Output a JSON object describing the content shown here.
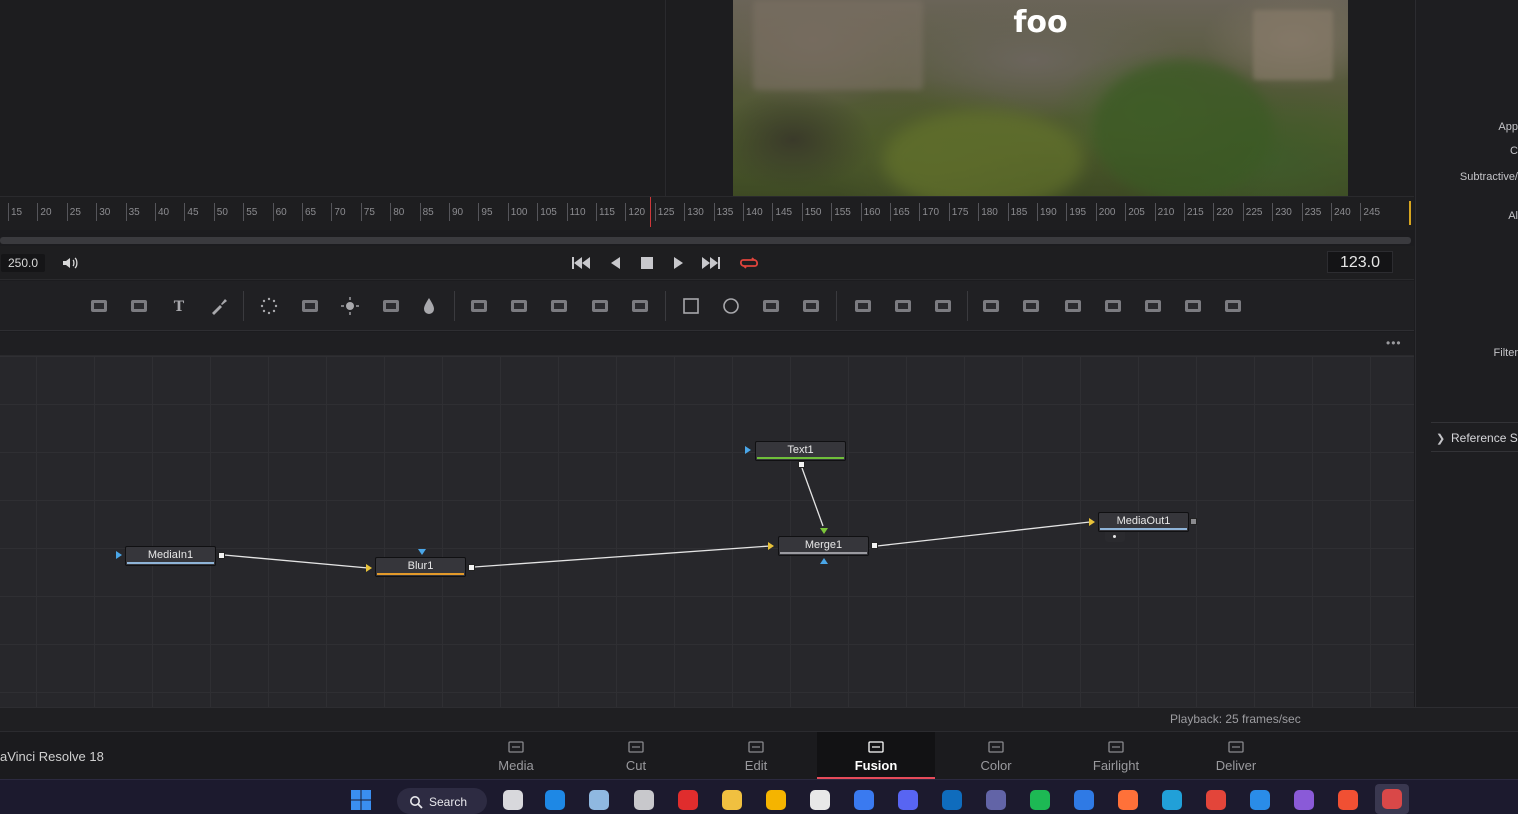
{
  "viewer": {
    "overlay_text": "foo"
  },
  "ruler": {
    "labels": [
      "15",
      "20",
      "25",
      "30",
      "35",
      "40",
      "45",
      "50",
      "55",
      "60",
      "65",
      "70",
      "75",
      "80",
      "85",
      "90",
      "95",
      "100",
      "105",
      "110",
      "115",
      "120",
      "125",
      "130",
      "135",
      "140",
      "145",
      "150",
      "155",
      "160",
      "165",
      "170",
      "175",
      "180",
      "185",
      "190",
      "195",
      "200",
      "205",
      "210",
      "215",
      "220",
      "225",
      "230",
      "235",
      "240",
      "245"
    ]
  },
  "transport": {
    "end_frame": "250.0",
    "current_frame": "123.0",
    "buttons": [
      "go-to-start",
      "step-back",
      "stop",
      "play",
      "go-to-end",
      "loop"
    ]
  },
  "toolbar": {
    "tools": [
      "background-icon",
      "fast-noise-icon",
      "text-icon",
      "paint-icon",
      "particles-icon",
      "color-curves-icon",
      "brightness-contrast-icon",
      "color-corrector-icon",
      "blur-drop-icon",
      "transform-icon",
      "merge-icon",
      "matte-control-icon",
      "resize-icon",
      "loop-icon",
      "rectangle-mask-icon",
      "ellipse-mask-icon",
      "polygon-mask-icon",
      "bspline-mask-icon",
      "particle-emitter-icon",
      "particle-render-icon",
      "particle-style-icon",
      "image-plane-3d-icon",
      "shape-3d-icon",
      "text-3d-icon",
      "merge-3d-icon",
      "renderer-3d-icon",
      "camera-3d-icon",
      "light-3d-icon"
    ]
  },
  "nodes": {
    "text1": "Text1",
    "mediain1": "MediaIn1",
    "blur1": "Blur1",
    "merge1": "Merge1",
    "mediaout1": "MediaOut1"
  },
  "status": {
    "playback": "Playback: 25 frames/sec"
  },
  "app": {
    "name": "aVinci Resolve 18"
  },
  "pages": [
    {
      "label": "Media",
      "icon": "media-page-icon"
    },
    {
      "label": "Cut",
      "icon": "cut-page-icon"
    },
    {
      "label": "Edit",
      "icon": "edit-page-icon"
    },
    {
      "label": "Fusion",
      "icon": "fusion-page-icon",
      "active": true
    },
    {
      "label": "Color",
      "icon": "color-page-icon"
    },
    {
      "label": "Fairlight",
      "icon": "fairlight-page-icon"
    },
    {
      "label": "Deliver",
      "icon": "deliver-page-icon"
    }
  ],
  "inspector": {
    "labels": [
      "App",
      "C",
      "Subtractive/",
      "Al",
      "Filter"
    ],
    "reference": "Reference S"
  },
  "taskbar": {
    "search": "Search",
    "apps": [
      "start-icon",
      "task-view-icon",
      "l-app-icon",
      "photos-icon",
      "obs-icon",
      "flash-app-icon",
      "clipboard-app-icon",
      "file-explorer-icon",
      "clock-app-icon",
      "calendar-app-icon",
      "discord-icon",
      "outlook-icon",
      "teams-icon",
      "spotify-icon",
      "todo-icon",
      "firefox-icon",
      "edge-icon",
      "chrome-icon",
      "vscode-icon",
      "visual-studio-icon",
      "git-app-icon",
      "davinci-resolve-icon"
    ]
  },
  "colors": {
    "accent": "#e64b5a",
    "playhead": "#d0383a",
    "loop": "#e0443c"
  }
}
